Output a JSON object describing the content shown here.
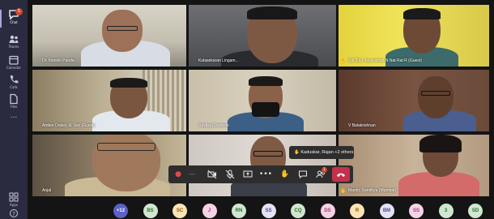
{
  "sidebar": {
    "items": [
      {
        "label": "Chat",
        "badge": "5"
      },
      {
        "label": "Teams"
      },
      {
        "label": "Calendar"
      },
      {
        "label": "Calls"
      },
      {
        "label": "Files"
      },
      {
        "label": "..."
      },
      {
        "label": "Apps"
      },
      {
        "label": "?"
      }
    ]
  },
  "tiles": [
    {
      "name": "Dr. Manish Pande...",
      "hand": false
    },
    {
      "name": "Kulasekaran Lingam...",
      "hand": false
    },
    {
      "name": "Sai (Dr.) Jayaraman N Nat Rat R (Guest)",
      "hand": true
    },
    {
      "name": "Amber Dubey Jt. Sec (Guest)",
      "hand": false
    },
    {
      "name": "Raviteja Devkote",
      "hand": false
    },
    {
      "name": "V Balakrishnan",
      "hand": false
    },
    {
      "name": "Anjal",
      "hand": false
    },
    {
      "name": "",
      "hand": false
    },
    {
      "name": "Mantri, Sandhya (Mumbai)",
      "hand": true
    }
  ],
  "tooltip": {
    "text": "Kaduskar, Rajan +2 others"
  },
  "controls": {
    "hangup_icon": "phone-hangup-icon",
    "reactions_count": "1"
  },
  "roster": [
    {
      "initials": "+12",
      "color": "#5b5fc7",
      "text": "#ffffff"
    },
    {
      "initials": "BS",
      "color": "#cfe7cf",
      "text": "#2e6b2e"
    },
    {
      "initials": "SC",
      "color": "#fbe3b4",
      "text": "#8a5a00"
    },
    {
      "initials": "J",
      "color": "#f6d2e5",
      "text": "#a33b73"
    },
    {
      "initials": "RN",
      "color": "#cfe7cf",
      "text": "#2e6b2e"
    },
    {
      "initials": "SS",
      "color": "#e3e3f5",
      "text": "#4a4a8a"
    },
    {
      "initials": "CQ",
      "color": "#cfe7cf",
      "text": "#2e6b2e"
    },
    {
      "initials": "DS",
      "color": "#f6d2e5",
      "text": "#a33b73"
    },
    {
      "initials": "R",
      "color": "#fbe3b4",
      "text": "#8a5a00"
    },
    {
      "initials": "BM",
      "color": "#e3e3f5",
      "text": "#4a4a8a"
    },
    {
      "initials": "SS",
      "color": "#f6d2e5",
      "text": "#a33b73"
    },
    {
      "initials": "3",
      "color": "#cfe7cf",
      "text": "#2e6b2e"
    },
    {
      "initials": "SD",
      "color": "#cfe7cf",
      "text": "#2e6b2e"
    }
  ]
}
